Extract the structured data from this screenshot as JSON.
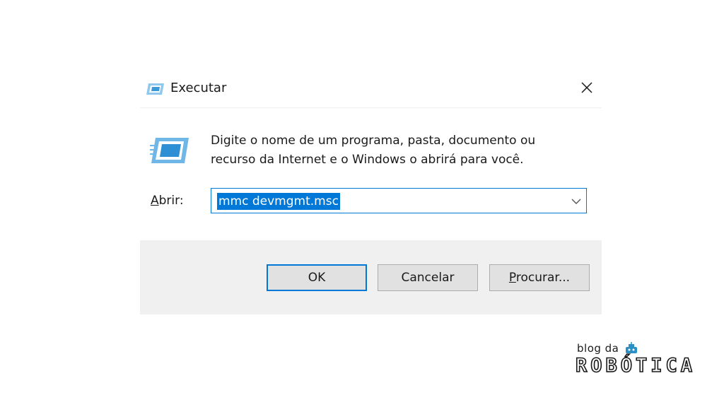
{
  "dialog": {
    "title": "Executar",
    "description_lines": [
      "Digite o nome de um programa, pasta, documento ou",
      "recurso da Internet e o Windows o abrirá para você."
    ],
    "open_label_underlined": "A",
    "open_label_rest": "brir:",
    "open_value": "mmc devmgmt.msc",
    "buttons": {
      "ok": "OK",
      "cancel": "Cancelar",
      "browse_underlined": "P",
      "browse_rest": "rocurar..."
    }
  },
  "logo": {
    "top": "blog da",
    "word": "ROBÓTICA"
  },
  "colors": {
    "accent": "#0078d7",
    "footer_bg": "#f0f0f0",
    "button_bg": "#e1e1e1"
  },
  "icons": [
    "run-icon",
    "close-icon",
    "chevron-down-icon",
    "robot-logo-icon"
  ]
}
